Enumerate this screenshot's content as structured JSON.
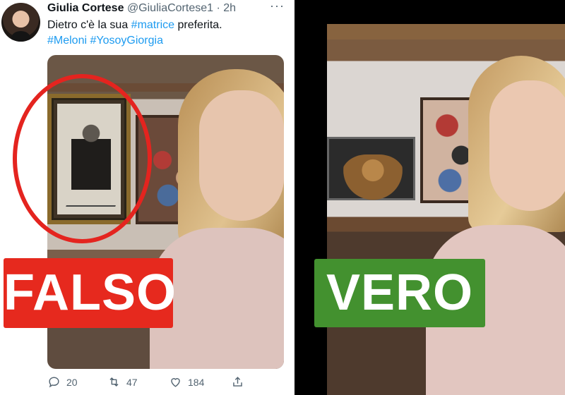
{
  "tweet": {
    "author_name": "Giulia Cortese",
    "author_handle": "@GiuliaCortese1",
    "separator": "·",
    "time": "2h",
    "more_icon": "more-horizontal-icon",
    "text_before": "Dietro c'è la sua ",
    "text_hashtag": "#matrice",
    "text_after": " preferita.",
    "hashtags_line": [
      "#Meloni",
      "#YosoyGiorgia"
    ],
    "actions": {
      "replies": "20",
      "retweets": "47",
      "likes": "184"
    }
  },
  "labels": {
    "falso": "FALSO",
    "vero": "VERO"
  },
  "colors": {
    "falso_bg": "#e6291e",
    "vero_bg": "#43912f",
    "highlight_ring": "#e4241f",
    "hashtag_blue": "#1d9bf0"
  }
}
